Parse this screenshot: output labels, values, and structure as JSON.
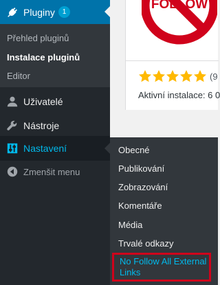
{
  "sidebar": {
    "plugins": {
      "label": "Pluginy",
      "badge": "1",
      "icon": "plug-icon"
    },
    "plugins_submenu": [
      {
        "label": "Přehled pluginů",
        "current": false
      },
      {
        "label": "Instalace pluginů",
        "current": true
      },
      {
        "label": "Editor",
        "current": false
      }
    ],
    "users": {
      "label": "Uživatelé",
      "icon": "user-icon"
    },
    "tools": {
      "label": "Nástroje",
      "icon": "wrench-icon"
    },
    "settings": {
      "label": "Nastavení",
      "icon": "settings-sliders-icon"
    },
    "collapse": {
      "label": "Zmenšit menu",
      "icon": "collapse-arrow-icon"
    }
  },
  "settings_flyout": {
    "items": [
      "Obecné",
      "Publikování",
      "Zobrazování",
      "Komentáře",
      "Média",
      "Trvalé odkazy"
    ],
    "highlighted_item": "No Follow All External Links"
  },
  "plugin_card": {
    "logo_text": "FOLLOW",
    "rating_stars": 5,
    "rating_count": "(9",
    "active_installs": "Aktivní instalace: 6 0"
  },
  "colors": {
    "sidebar_bg": "#23282d",
    "submenu_bg": "#32373c",
    "current_blue": "#0073aa",
    "link_blue": "#00b9eb",
    "star_orange": "#ffb900",
    "highlight_red": "#d0021b"
  }
}
